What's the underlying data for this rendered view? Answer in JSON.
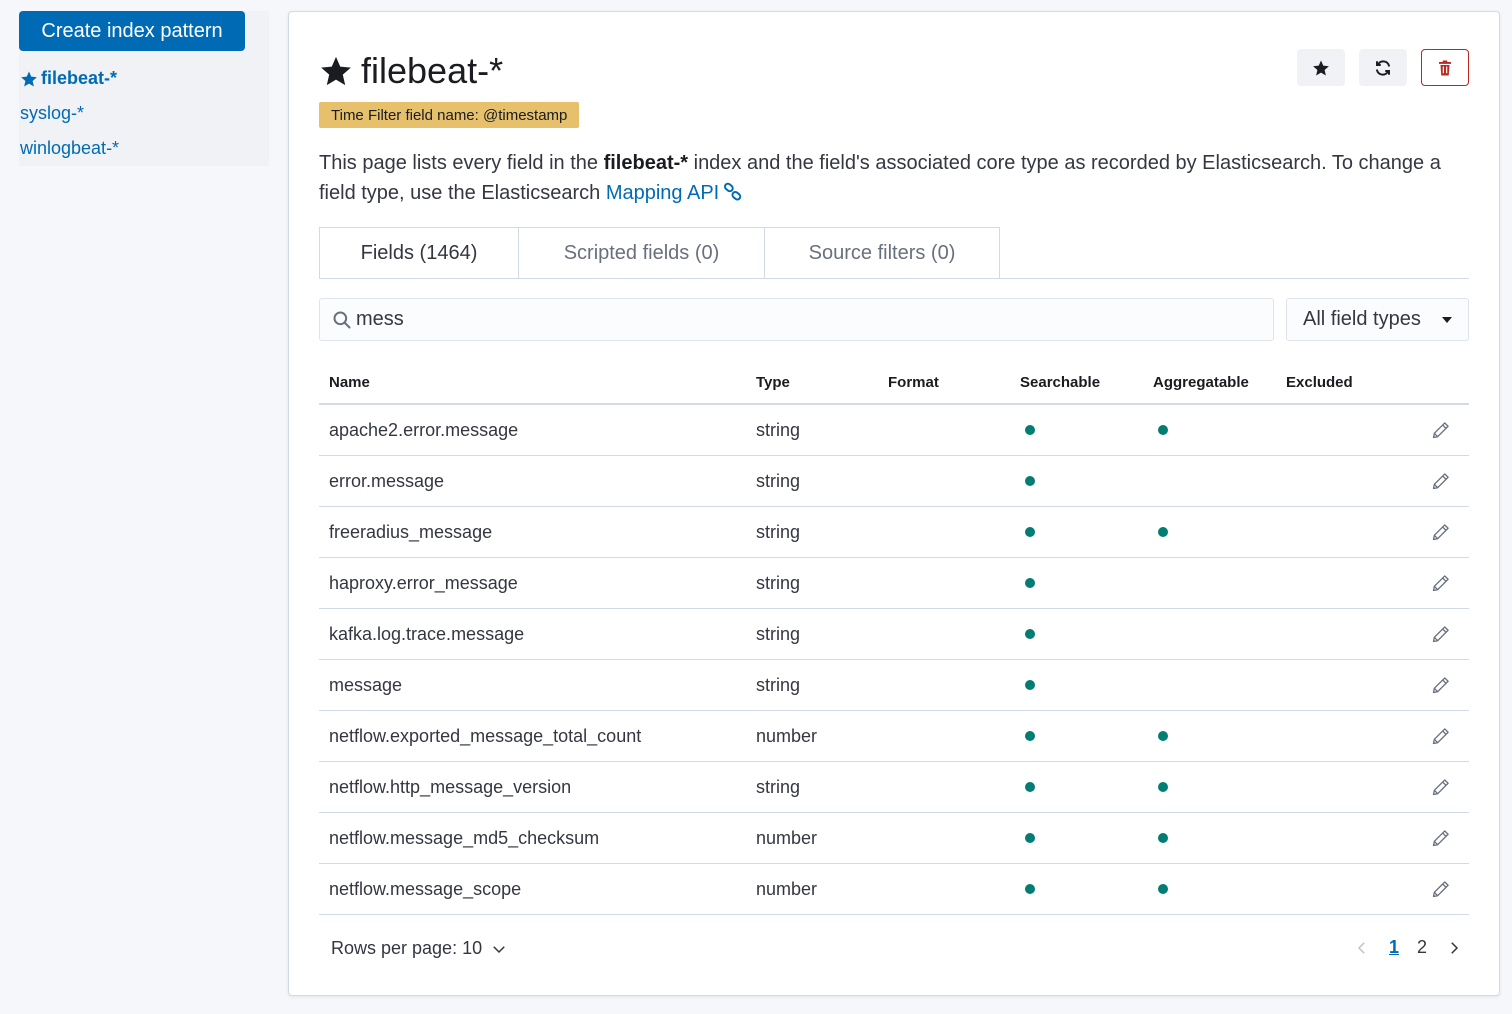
{
  "sidebar": {
    "create_label": "Create index pattern",
    "items": [
      {
        "label": "filebeat-*",
        "active": true
      },
      {
        "label": "syslog-*",
        "active": false
      },
      {
        "label": "winlogbeat-*",
        "active": false
      }
    ]
  },
  "header": {
    "title": "filebeat-*",
    "time_filter_badge": "Time Filter field name: @timestamp",
    "icons": [
      "star-icon",
      "refresh-icon",
      "trash-icon"
    ]
  },
  "description": {
    "part1": "This page lists every field in the ",
    "index_name": "filebeat-*",
    "part2": " index and the field's associated core type as recorded by Elasticsearch. To change a field type, use the Elasticsearch ",
    "link_text": "Mapping API"
  },
  "tabs": [
    {
      "label": "Fields (1464)",
      "selected": true
    },
    {
      "label": "Scripted fields (0)",
      "selected": false
    },
    {
      "label": "Source filters (0)",
      "selected": false
    }
  ],
  "search": {
    "value": "mess",
    "placeholder": "Search"
  },
  "type_filter": {
    "label": "All field types"
  },
  "table": {
    "columns": {
      "name": "Name",
      "type": "Type",
      "format": "Format",
      "searchable": "Searchable",
      "aggregatable": "Aggregatable",
      "excluded": "Excluded"
    },
    "rows": [
      {
        "name": "apache2.error.message",
        "type": "string",
        "searchable": true,
        "aggregatable": true
      },
      {
        "name": "error.message",
        "type": "string",
        "searchable": true,
        "aggregatable": false
      },
      {
        "name": "freeradius_message",
        "type": "string",
        "searchable": true,
        "aggregatable": true
      },
      {
        "name": "haproxy.error_message",
        "type": "string",
        "searchable": true,
        "aggregatable": false
      },
      {
        "name": "kafka.log.trace.message",
        "type": "string",
        "searchable": true,
        "aggregatable": false
      },
      {
        "name": "message",
        "type": "string",
        "searchable": true,
        "aggregatable": false
      },
      {
        "name": "netflow.exported_message_total_count",
        "type": "number",
        "searchable": true,
        "aggregatable": true
      },
      {
        "name": "netflow.http_message_version",
        "type": "string",
        "searchable": true,
        "aggregatable": true
      },
      {
        "name": "netflow.message_md5_checksum",
        "type": "number",
        "searchable": true,
        "aggregatable": true
      },
      {
        "name": "netflow.message_scope",
        "type": "number",
        "searchable": true,
        "aggregatable": true
      }
    ]
  },
  "footer": {
    "rows_per_page": "Rows per page: 10",
    "pages": [
      "1",
      "2"
    ],
    "current_page": "1"
  },
  "colors": {
    "primary": "#006bb4",
    "badge": "#e6c06b",
    "dot": "#017d73",
    "danger": "#bd271e"
  }
}
